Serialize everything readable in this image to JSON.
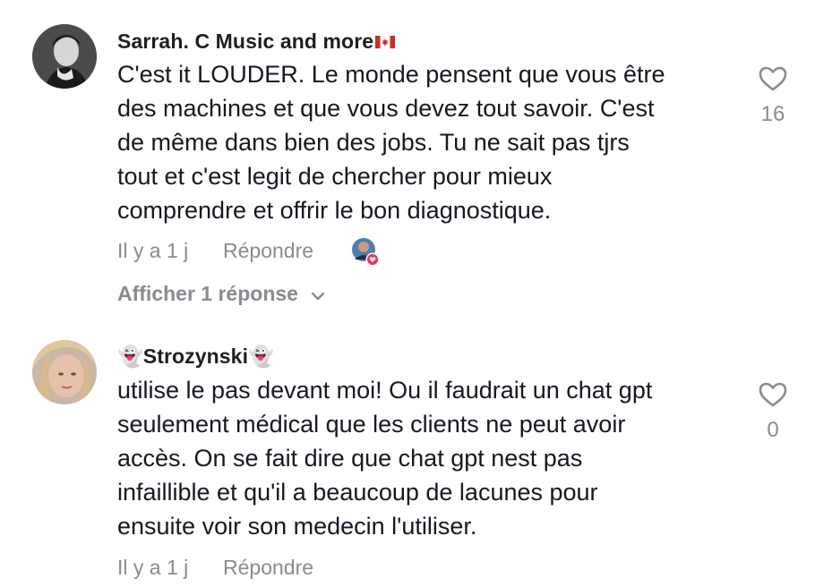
{
  "comments": [
    {
      "username": "Sarrah. C Music and more",
      "username_suffix_flag": "canada-flag-icon",
      "text": "C'est it LOUDER. Le monde pensent que vous être\ndes machines et que vous devez tout savoir. C'est\nde même dans bien des jobs. Tu ne sait pas tjrs\ntout et c'est legit de chercher pour mieux\ncomprendre et offrir le bon diagnostique.",
      "time": "Il y a 1 j",
      "reply_label": "Répondre",
      "like_count": "16",
      "view_replies_label": "Afficher 1 réponse",
      "liked_by_creator": true
    },
    {
      "username_prefix_emoji": "👻",
      "username": "Strozynski",
      "username_suffix_emoji": "👻",
      "text": "utilise le pas devant moi! Ou il faudrait un chat gpt\nseulement médical que les clients ne peut avoir\naccès. On se fait dire que chat gpt nest pas\ninfaillible et qu'il a beaucoup de lacunes pour\nensuite voir son medecin l'utiliser.",
      "time": "Il y a 1 j",
      "reply_label": "Répondre",
      "like_count": "0"
    }
  ],
  "colors": {
    "text": "#161823",
    "muted": "#8a8b91",
    "like_badge": "#fe2c55"
  }
}
